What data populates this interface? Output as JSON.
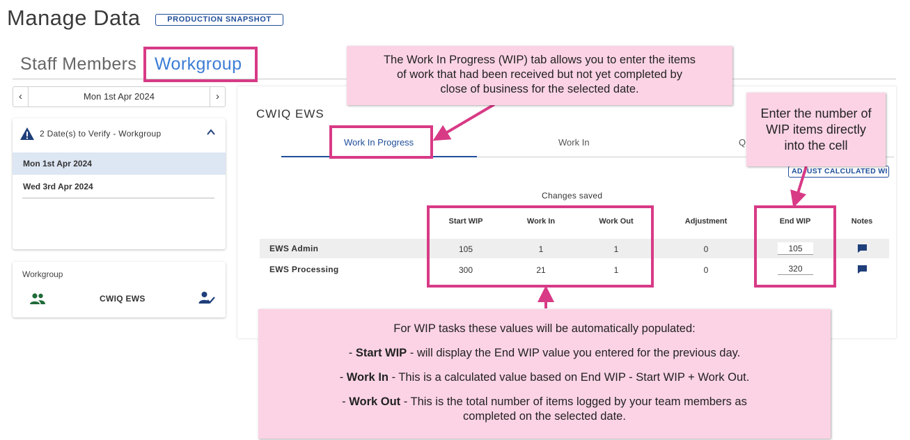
{
  "page": {
    "title": "Manage Data",
    "badge": "PRODUCTION SNAPSHOT"
  },
  "main_tabs": [
    {
      "label": "Staff Members",
      "active": false
    },
    {
      "label": "Workgroup",
      "active": true
    }
  ],
  "date_nav": {
    "prev": "‹",
    "date": "Mon 1st Apr 2024",
    "next": "›"
  },
  "verify": {
    "header": "2 Date(s) to Verify - Workgroup",
    "dates": [
      "Mon 1st Apr 2024",
      "Wed 3rd Apr 2024"
    ]
  },
  "workgroup": {
    "label": "Workgroup",
    "name": "CWIQ EWS"
  },
  "card": {
    "title": "CWIQ EWS",
    "tabs": [
      "Work In Progress",
      "Work In",
      "Q"
    ],
    "adjust_button": "ADJUST CALCULATED WI",
    "status": "Changes saved"
  },
  "table": {
    "columns": [
      "Start WIP",
      "Work In",
      "Work Out",
      "Adjustment",
      "End WIP",
      "Notes"
    ],
    "rows": [
      {
        "name": "EWS Admin",
        "start_wip": "105",
        "work_in": "1",
        "work_out": "1",
        "adjustment": "0",
        "end_wip": "105"
      },
      {
        "name": "EWS Processing",
        "start_wip": "300",
        "work_in": "21",
        "work_out": "1",
        "adjustment": "0",
        "end_wip": "320"
      }
    ]
  },
  "callouts": {
    "top": [
      "The Work In Progress (WIP) tab allows you to enter the items",
      "of work that had been received but not yet completed by",
      "close of business for the selected date."
    ],
    "right": [
      "Enter the number of",
      "WIP items directly",
      "into the cell"
    ],
    "bottom": {
      "intro": "For WIP tasks these values will be automatically populated:",
      "items": [
        {
          "prefix": "- ",
          "term": "Start WIP",
          "text": " - will display the End WIP value you entered for the previous day."
        },
        {
          "prefix": "- ",
          "term": "Work In",
          "text": " - This is a calculated value based on End WIP - Start WIP + Work Out."
        },
        {
          "prefix": "- ",
          "term": "Work Out",
          "text": " - This is the total number of items logged by your team members as"
        }
      ],
      "continuation": "completed on the selected date."
    }
  },
  "colors": {
    "accent": "#1f4e9a",
    "link": "#3c7dd6",
    "highlight": "#d83a86",
    "callout_bg": "#fcd3e5",
    "selected_row": "#dde6f3"
  }
}
